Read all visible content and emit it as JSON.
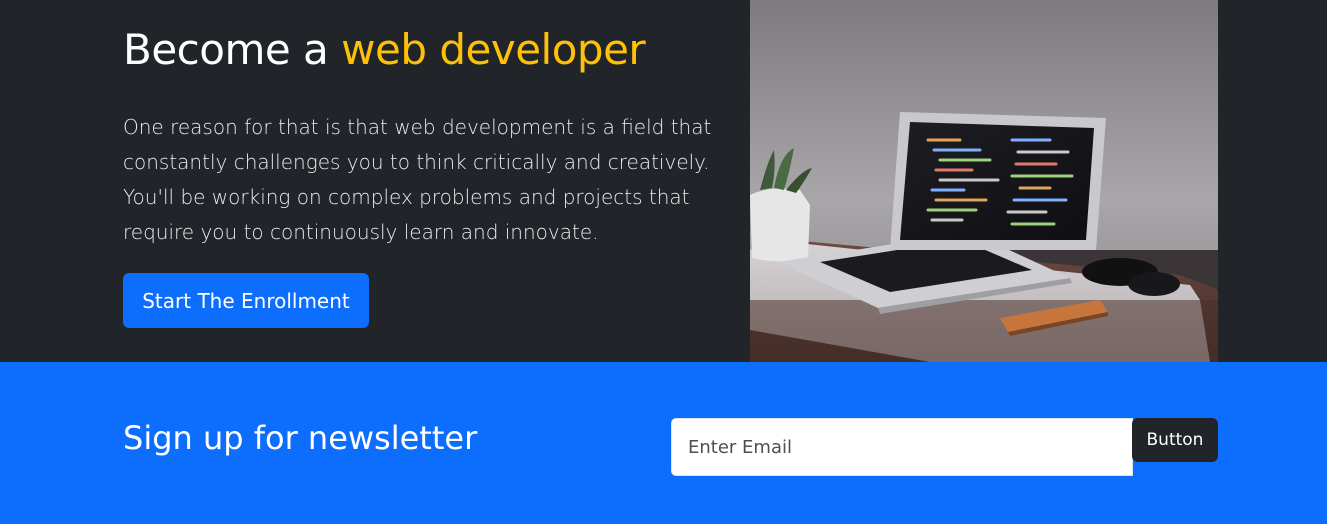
{
  "hero": {
    "title_prefix": "Become a ",
    "title_highlight": "web developer",
    "lead": "One reason for that is that web development is a field that constantly challenges you to think critically and creatively. You'll be working on complex problems and projects that require you to continuously learn and innovate.",
    "cta_label": "Start The Enrollment",
    "image_icon": "laptop-photo"
  },
  "newsletter": {
    "title": "Sign up for newsletter",
    "email_placeholder": "Enter Email",
    "email_value": "",
    "button_label": "Button"
  },
  "colors": {
    "hero_bg": "#212529",
    "accent": "#ffc107",
    "primary": "#0d6efd",
    "dark_button": "#212529"
  }
}
